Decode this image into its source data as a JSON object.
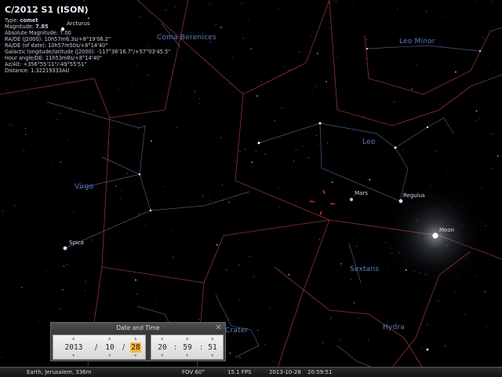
{
  "object_info": {
    "title": "C/2012 S1 (ISON)",
    "type_label": "Type:",
    "type_value": "comet",
    "magnitude_label": "Magnitude:",
    "magnitude_value": "7.85",
    "lines": [
      "Absolute Magnitude: 7.00",
      "RA/DE (J2000): 10h57m6.3s/+8°19'06.2\"",
      "RA/DE (of date): 10h57m50s/+8°14'40\"",
      "Galactic longitude/latitude (J2000): -117°36'16.7\"/+57°03'45.5\"",
      "Hour angle/DE: 11h53m8s/+8°14'40\"",
      "Az/Alt: +356°55'11\"/-49°55'51\"",
      "Distance: 1.32219333AU"
    ]
  },
  "constellation_labels": {
    "coma": "Coma Berenices",
    "leo_minor": "Leo Minor",
    "leo": "Leo",
    "virgo": "Virgo",
    "sextans": "Sextans",
    "hydra": "Hydra",
    "crater": "Crater"
  },
  "star_labels": {
    "arcturus": "Arcturus",
    "mars": "Mars",
    "regulus": "Regulus",
    "moon": "Moon",
    "spica": "Spica"
  },
  "date_time_dialog": {
    "title": "Date and Time",
    "close_glyph": "✕",
    "year": "2013",
    "month": "10",
    "day": "28",
    "hour": "20",
    "minute": "59",
    "second": "51",
    "date_sep": "/",
    "time_sep": ":",
    "arrow_up": "▲",
    "arrow_down": "▼"
  },
  "status_bar": {
    "location": "Earth, Jerusalem, 336m",
    "fov": "FOV 60°",
    "fps": "15.1 FPS",
    "date": "2013-10-28",
    "time": "20:59:51"
  },
  "colors": {
    "constellation_lines": "#5d6fa8",
    "boundaries": "#a43d3d",
    "labels": "#5d7fc0",
    "selection_marker": "#e02424",
    "highlight": "#f6b73c"
  }
}
